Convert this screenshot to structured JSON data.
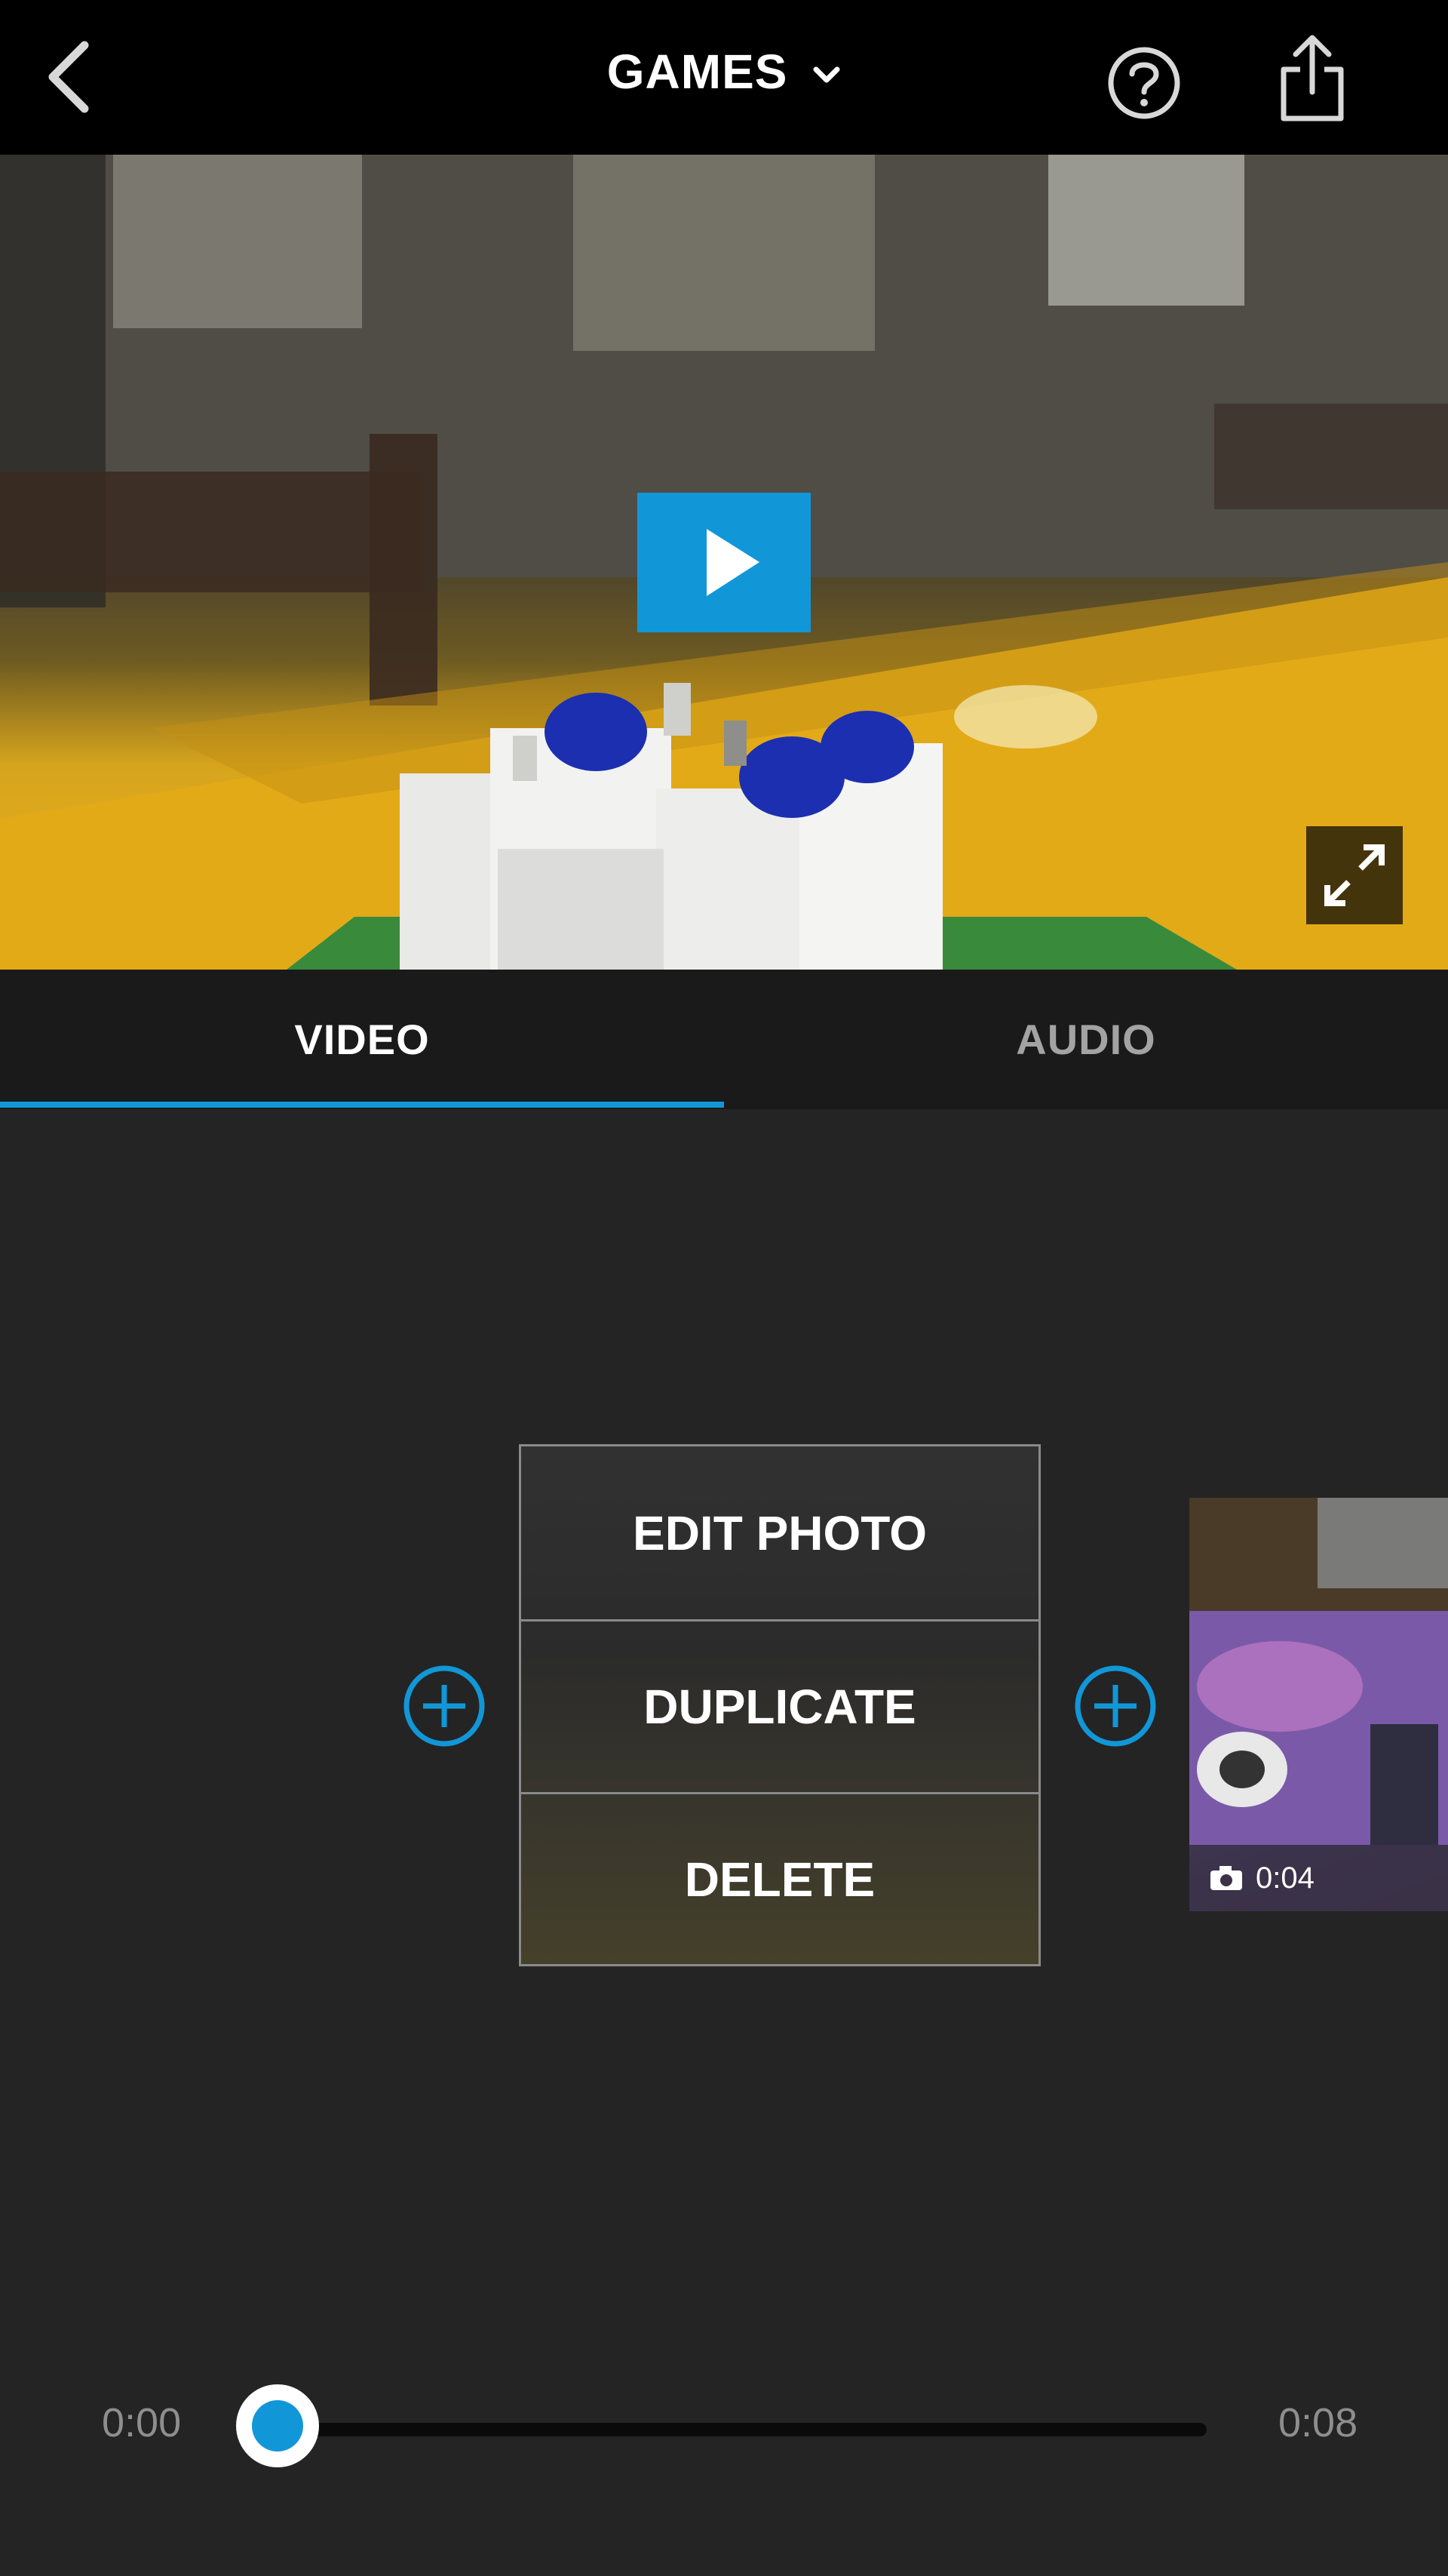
{
  "header": {
    "title": "GAMES",
    "icons": [
      "back-icon",
      "chevron-down-icon",
      "help-icon",
      "share-icon"
    ]
  },
  "tabs": [
    {
      "label": "VIDEO",
      "active": true
    },
    {
      "label": "AUDIO",
      "active": false
    }
  ],
  "context_menu": {
    "items": [
      "EDIT PHOTO",
      "DUPLICATE",
      "DELETE"
    ]
  },
  "next_clip": {
    "duration": "0:04",
    "icon": "camera-icon"
  },
  "timeline": {
    "start_time": "0:00",
    "end_time": "0:08",
    "progress": 0
  },
  "colors": {
    "accent": "#1197d8",
    "background": "#242424",
    "topbar": "#000000"
  }
}
